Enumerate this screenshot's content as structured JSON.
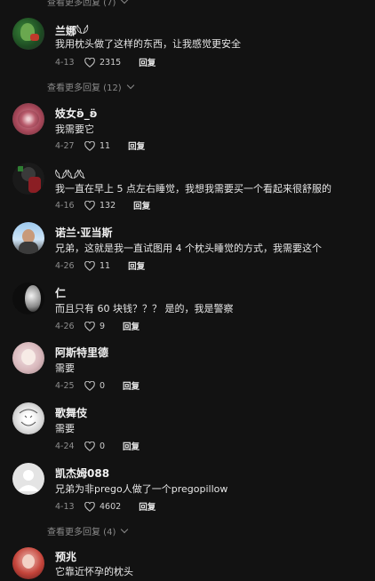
{
  "top_more": "查看更多回复 (7)",
  "mid_more": "查看更多回复 (12)",
  "bottom_more": "查看更多回复 (4)",
  "comments": [
    {
      "name": "兰娜𓆩𓆪",
      "text": "我用枕头做了这样的东西，让我感觉更安全",
      "date": "4-13",
      "likes": "2315",
      "reply": "回复"
    },
    {
      "name": "妓女ʚ̈_ʚ̈",
      "text": "我需要它",
      "date": "4-27",
      "likes": "11",
      "reply": "回复"
    },
    {
      "name": "𓆩𓆪𓆩𓆪𓆩",
      "text": "我一直在早上 5 点左右睡觉，我想我需要买一个看起来很舒服的",
      "date": "4-16",
      "likes": "132",
      "reply": "回复"
    },
    {
      "name": "诺兰·亚当斯",
      "text": "兄弟，这就是我一直试图用 4 个枕头睡觉的方式，我需要这个",
      "date": "4-26",
      "likes": "11",
      "reply": "回复"
    },
    {
      "name": "仁",
      "text": "而且只有 60 块钱？？？ 是的，我是警察",
      "date": "4-26",
      "likes": "9",
      "reply": "回复"
    },
    {
      "name": "阿斯特里德",
      "text": "需要",
      "date": "4-25",
      "likes": "0",
      "reply": "回复"
    },
    {
      "name": "歌舞伎",
      "text": "需要",
      "date": "4-24",
      "likes": "0",
      "reply": "回复"
    },
    {
      "name": "凯杰姆088",
      "text": "兄弟为非prego人做了一个pregopillow",
      "date": "4-13",
      "likes": "4602",
      "reply": "回复"
    },
    {
      "name": "预兆",
      "text": "它靠近怀孕的枕头",
      "date": "",
      "likes": "",
      "reply": ""
    }
  ]
}
